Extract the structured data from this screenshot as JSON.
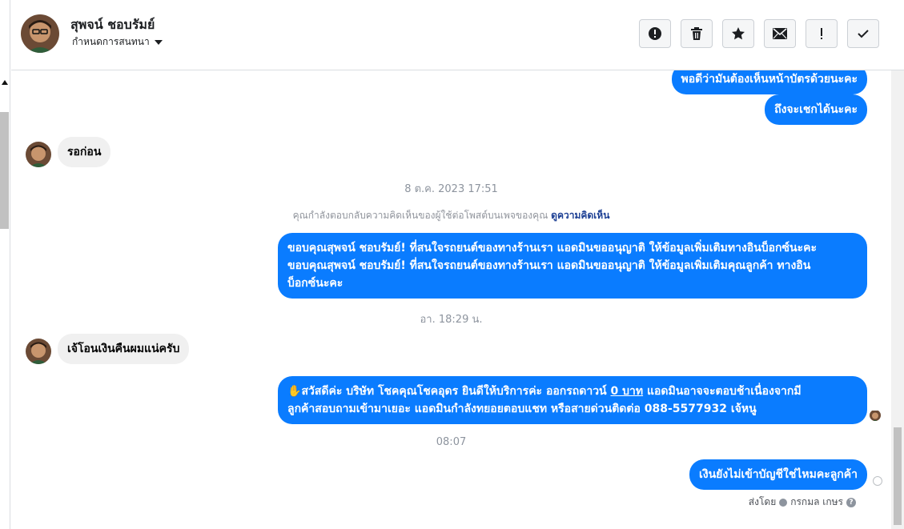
{
  "header": {
    "contact_name": "สุพจน์ ชอบรัมย์",
    "subtitle": "กำหนดการสนทนา",
    "avatar_icon": "user-avatar"
  },
  "toolbar": [
    {
      "name": "report-icon-button",
      "icon": "exclamation-circle-icon"
    },
    {
      "name": "delete-icon-button",
      "icon": "trash-icon"
    },
    {
      "name": "star-icon-button",
      "icon": "star-icon"
    },
    {
      "name": "mark-unread-icon-button",
      "icon": "envelope-icon"
    },
    {
      "name": "important-icon-button",
      "icon": "exclamation-icon"
    },
    {
      "name": "done-icon-button",
      "icon": "check-icon"
    }
  ],
  "messages": {
    "out_1": "พอดีว่ามันต้องเห็นหน้าบัตรด้วยนะคะ",
    "out_2": "ถึงจะเชกได้นะคะ",
    "in_1": "รอก่อน",
    "timestamp_1": "8 ต.ค. 2023 17:51",
    "context_text": "คุณกำลังตอบกลับความคิดเห็นของผู้ใช้ต่อโพสต์บนเพจของคุณ",
    "context_link": "ดูความคิดเห็น",
    "out_3_line1": "ขอบคุณสุพจน์ ชอบรัมย์! ที่สนใจรถยนต์ของทางร้านเรา แอดมินขออนุญาติ ให้ข้อมูลเพิ่มเติมทางอินบ็อกซ์นะคะ",
    "out_3_line2": "ขอบคุณสุพจน์ ชอบรัมย์! ที่สนใจรถยนต์ของทางร้านเรา แอดมินขออนุญาติ ให้ข้อมูลเพิ่มเติมคุณลูกค้า ทางอิน",
    "out_3_line3": "บ็อกซ์นะคะ",
    "timestamp_2": "อา. 18:29 น.",
    "in_2": "เจ้โอนเงินคืนผมแน่ครับ",
    "out_4_emoji": "✋",
    "out_4_part1": "สวัสดีค่ะ บริษัท โชคคุณโชคอุดร ยินดีให้บริการค่ะ ออกรถดาวน์",
    "out_4_underlined": "0 บาท",
    "out_4_part2": "แอดมินอาจจะตอบช้าเนื่องจากมี",
    "out_4_line2": "ลูกค้าสอบถามเข้ามาเยอะ แอดมินกำลังทยอยตอบแชท หรือสายด่วนติดต่อ 088-5577932 เจ้หนู",
    "timestamp_3": "08:07",
    "out_5": "เงินยังไม่เข้าบัญชีใช่ไหมคะลูกค้า",
    "sent_by_label": "ส่งโดย",
    "sent_by_name": "กรกมล เกษร"
  }
}
